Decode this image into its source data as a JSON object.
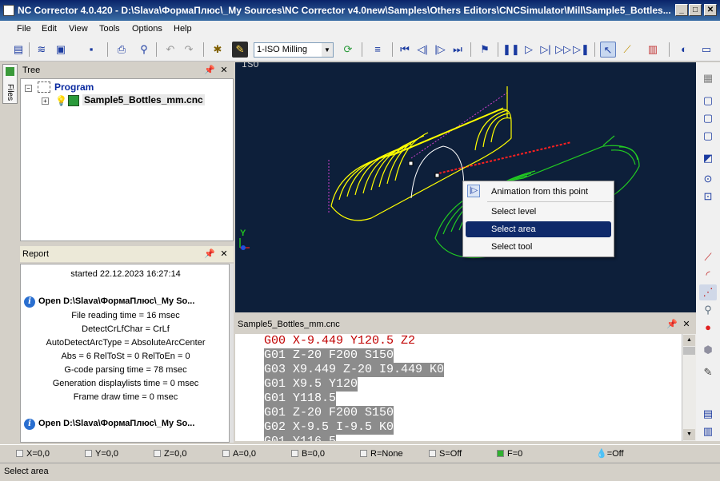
{
  "window": {
    "title": "NC Corrector 4.0.420  -  D:\\Slava\\ФормаПлюс\\_My Sources\\NC Corrector v4.0new\\Samples\\Others Editors\\CNCSimulator\\Mill\\Sample5_Bottles...",
    "minimize": "_",
    "maximize": "□",
    "close": "✕"
  },
  "menu": [
    "File",
    "Edit",
    "View",
    "Tools",
    "Options",
    "Help"
  ],
  "toolbar": {
    "machine_combo": "1-ISO Milling"
  },
  "side_tab": {
    "files": "Files"
  },
  "tree": {
    "title": "Tree",
    "root": "Program",
    "file": "Sample5_Bottles_mm.cnc"
  },
  "report": {
    "title": "Report",
    "started": "started 22.12.2023 16:27:14",
    "open1": "Open D:\\Slava\\ФормаПлюс\\_My So...",
    "lines": [
      "File reading time = 16 msec",
      "DetectCrLfChar = CrLf",
      "AutoDetectArcType = AbsoluteArcCenter",
      "Abs = 6 RelToSt = 0 RelToEn = 0",
      "G-code parsing time = 78 msec",
      "Generation displaylists time = 0 msec",
      "Frame draw time = 0 msec"
    ],
    "open2": "Open D:\\Slava\\ФормаПлюс\\_My So..."
  },
  "viewport": {
    "view_label": "ISO",
    "axis_y": "Y"
  },
  "context_menu": {
    "items": [
      "Animation from this point",
      "Select level",
      "Select area",
      "Select tool"
    ],
    "selected": "Select area"
  },
  "code": {
    "tab": "Sample5_Bottles_mm.cnc",
    "lines": [
      "G00 X-9.449 Y120.5 Z2",
      "G01 Z-20 F200 S150",
      "G03 X9.449 Z-20 I9.449 K0",
      "G01 X9.5 Y120",
      "G01 Y118.5",
      "G01 Z-20 F200 S150",
      "G02 X-9.5 I-9.5 K0",
      "G01 Y116.5"
    ]
  },
  "status": {
    "fields": [
      "X=0,0",
      "Y=0,0",
      "Z=0,0",
      "A=0,0",
      "B=0,0",
      "R=None",
      "S=Off",
      "F=0",
      "=Off"
    ],
    "message": "Select area"
  },
  "colors": {
    "viewport_bg": "#0d1f3a",
    "toolpath_yellow": "#ffff00",
    "toolpath_green": "#22cc22",
    "selection": "#0f2a6a"
  }
}
